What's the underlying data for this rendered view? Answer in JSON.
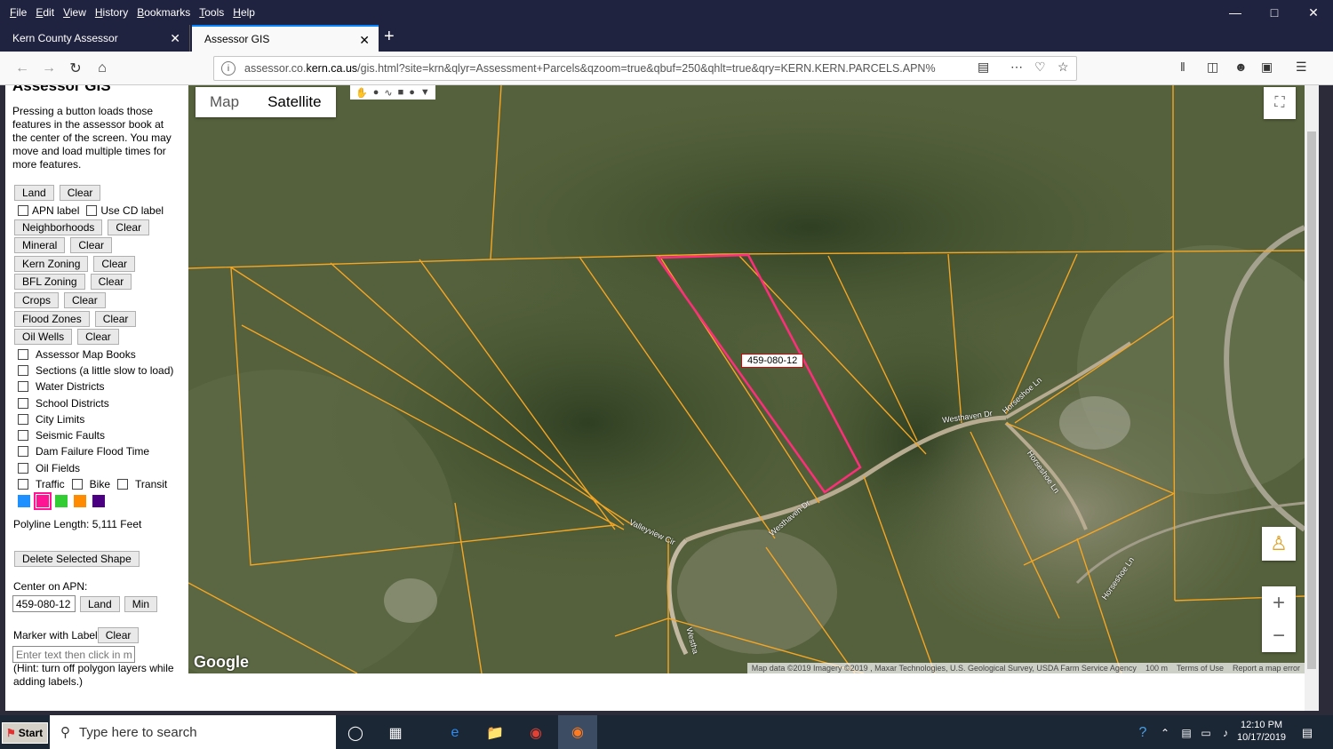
{
  "menubar": {
    "items": [
      "File",
      "Edit",
      "View",
      "History",
      "Bookmarks",
      "Tools",
      "Help"
    ]
  },
  "tabs": [
    {
      "title": "Kern County Assessor"
    },
    {
      "title": "Assessor GIS"
    }
  ],
  "address_bar": {
    "url_prefix": "assessor.co.",
    "url_domain": "kern.ca.us",
    "url_rest": "/gis.html?site=krn&qlyr=Assessment+Parcels&qzoom=true&qbuf=250&qhlt=true&qry=KERN.KERN.PARCELS.APN%"
  },
  "panel": {
    "title": "Assessor GIS",
    "intro": "Pressing a button loads those features in the assessor book at the center of the screen. You may move and load multiple times for more features.",
    "land": "Land",
    "clear": "Clear",
    "apn_label": "APN label",
    "use_cd_label": "Use CD label",
    "neighborhoods": "Neighborhoods",
    "mineral": "Mineral",
    "kern_zoning": "Kern Zoning",
    "bfl_zoning": "BFL Zoning",
    "crops": "Crops",
    "flood_zones": "Flood Zones",
    "oil_wells": "Oil Wells",
    "layers": [
      "Assessor Map Books",
      "Sections (a little slow to load)",
      "Water Districts",
      "School Districts",
      "City Limits",
      "Seismic Faults",
      "Dam Failure Flood Time",
      "Oil Fields"
    ],
    "traffic": "Traffic",
    "bike": "Bike",
    "transit": "Transit",
    "swatch_colors": [
      "#1e90ff",
      "#ff1493",
      "#32cd32",
      "#ff8c00",
      "#4b0082"
    ],
    "polyline_length": "Polyline Length: 5,111 Feet",
    "delete_shape": "Delete Selected Shape",
    "center_on_apn": "Center on APN:",
    "apn_value": "459-080-12",
    "min": "Min",
    "marker_with_label": "Marker with Label",
    "marker_placeholder": "Enter text then click in map",
    "hint": "(Hint: turn off polygon layers while adding labels.)"
  },
  "map": {
    "type_map": "Map",
    "type_satellite": "Satellite",
    "apn_label": "459-080-12",
    "roads": [
      "Westhaven Dr",
      "Horseshoe Ln",
      "Horseshoe Ln",
      "Horseshoe Ln",
      "Valleyview Cir",
      "Westhaven Dr",
      "Westha"
    ],
    "google": "Google",
    "attribution": "Map data ©2019 Imagery ©2019 , Maxar Technologies, U.S. Geological Survey, USDA Farm Service Agency",
    "scale": "100 m",
    "terms": "Terms of Use",
    "report": "Report a map error",
    "parcel_color": "#f5a623",
    "highlight_color": "#ff2d7a"
  },
  "taskbar": {
    "start": "Start",
    "search_placeholder": "Type here to search",
    "time": "12:10 PM",
    "date": "10/17/2019"
  }
}
